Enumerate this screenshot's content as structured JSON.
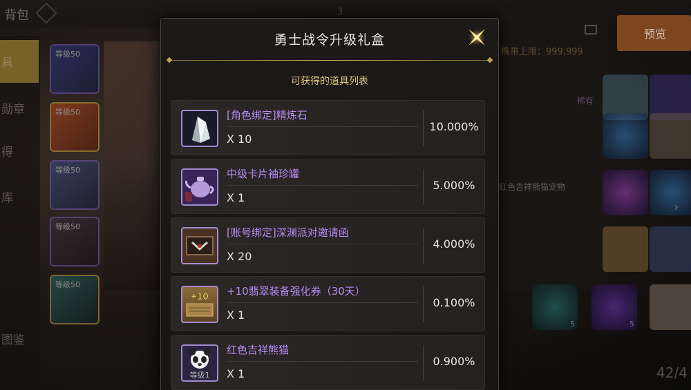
{
  "background": {
    "inventory_title": "背包",
    "nav_labels": [
      "具",
      "勋章",
      "得",
      "库",
      "图鉴"
    ],
    "slot_badges": [
      "等级50",
      "等级50",
      "等级50",
      "等级50",
      "等级50"
    ],
    "preview_button": "预览",
    "limit_text": "携带上限：999,999",
    "rare_label": "稀有",
    "panda_note": "红色吉祥熊猫宠物",
    "stack_counts": [
      "5",
      "5"
    ],
    "page_indicator": "42/4"
  },
  "dialog": {
    "title": "勇士战令升级礼盒",
    "subtitle": "可获得的道具列表",
    "items": [
      {
        "name": "[角色绑定]精炼石",
        "qty": "X 10",
        "prob": "10.000%",
        "icon": "crystal-icon"
      },
      {
        "name": "中级卡片袖珍罐",
        "qty": "X 1",
        "prob": "5.000%",
        "icon": "teapot-icon"
      },
      {
        "name": "[账号绑定]深渊派对邀请函",
        "qty": "X 20",
        "prob": "4.000%",
        "icon": "invitation-icon"
      },
      {
        "name": "+10翡翠装备强化券（30天）",
        "qty": "X 1",
        "prob": "0.100%",
        "icon": "ticket-icon",
        "icon_text": "+10"
      },
      {
        "name": "红色吉祥熊猫",
        "qty": "X 1",
        "prob": "0.900%",
        "icon": "panda-icon",
        "icon_text": "等级1"
      }
    ]
  },
  "colors": {
    "item_name": "#b98af5",
    "subtitle": "#e3c27a",
    "accent_gold": "#c8a458"
  }
}
